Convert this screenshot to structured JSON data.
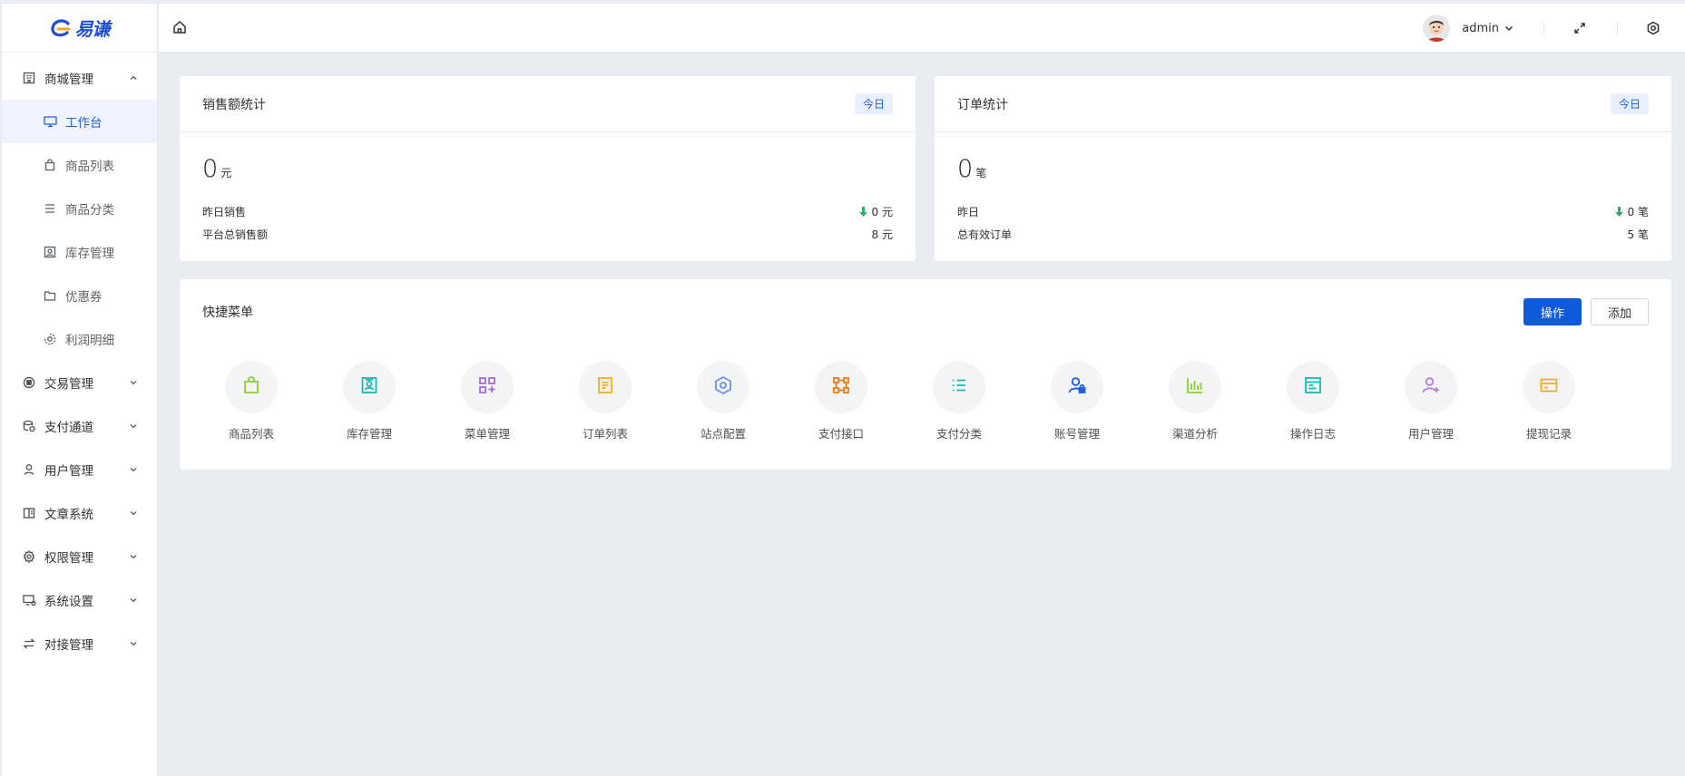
{
  "brand": {
    "name": "易谦"
  },
  "header": {
    "username": "admin"
  },
  "sidebar": {
    "group": {
      "label": "商城管理"
    },
    "sub_items": [
      {
        "label": "工作台",
        "icon": "monitor-icon",
        "active": true
      },
      {
        "label": "商品列表",
        "icon": "shopping-bag-icon"
      },
      {
        "label": "商品分类",
        "icon": "list-icon"
      },
      {
        "label": "库存管理",
        "icon": "inventory-icon"
      },
      {
        "label": "优惠券",
        "icon": "folder-icon"
      },
      {
        "label": "利润明细",
        "icon": "profit-icon"
      }
    ],
    "items": [
      {
        "label": "交易管理",
        "icon": "transaction-icon"
      },
      {
        "label": "支付通道",
        "icon": "payment-channel-icon"
      },
      {
        "label": "用户管理",
        "icon": "user-icon"
      },
      {
        "label": "文章系统",
        "icon": "article-icon"
      },
      {
        "label": "权限管理",
        "icon": "gear-icon"
      },
      {
        "label": "系统设置",
        "icon": "system-settings-icon"
      },
      {
        "label": "对接管理",
        "icon": "swap-icon"
      }
    ]
  },
  "sales": {
    "title": "销售额统计",
    "tag": "今日",
    "value": "0",
    "unit": "元",
    "row1_label": "昨日销售",
    "row1_value": "0 元",
    "row2_label": "平台总销售额",
    "row2_value": "8 元"
  },
  "orders": {
    "title": "订单统计",
    "tag": "今日",
    "value": "0",
    "unit": "笔",
    "row1_label": "昨日",
    "row1_value": "0 笔",
    "row2_label": "总有效订单",
    "row2_value": "5 笔"
  },
  "quick": {
    "title": "快捷菜单",
    "btn_operate": "操作",
    "btn_add": "添加",
    "items": [
      {
        "label": "商品列表",
        "icon": "shopping-bag-icon",
        "color": "#8ccf2e"
      },
      {
        "label": "库存管理",
        "icon": "inventory-icon",
        "color": "#1fb5b0"
      },
      {
        "label": "菜单管理",
        "icon": "menu-grid-icon",
        "color": "#a66ad8"
      },
      {
        "label": "订单列表",
        "icon": "order-list-icon",
        "color": "#f0b020"
      },
      {
        "label": "站点配置",
        "icon": "site-config-icon",
        "color": "#6b8ef0"
      },
      {
        "label": "支付接口",
        "icon": "payment-api-icon",
        "color": "#f07a12"
      },
      {
        "label": "支付分类",
        "icon": "payment-category-icon",
        "color": "#1fb5b0"
      },
      {
        "label": "账号管理",
        "icon": "account-icon",
        "color": "#1f5fe0"
      },
      {
        "label": "渠道分析",
        "icon": "bar-chart-icon",
        "color": "#8ccf2e"
      },
      {
        "label": "操作日志",
        "icon": "log-icon",
        "color": "#1fb5b0"
      },
      {
        "label": "用户管理",
        "icon": "add-user-icon",
        "color": "#b77ae0"
      },
      {
        "label": "提现记录",
        "icon": "withdraw-icon",
        "color": "#f0b020"
      }
    ]
  }
}
